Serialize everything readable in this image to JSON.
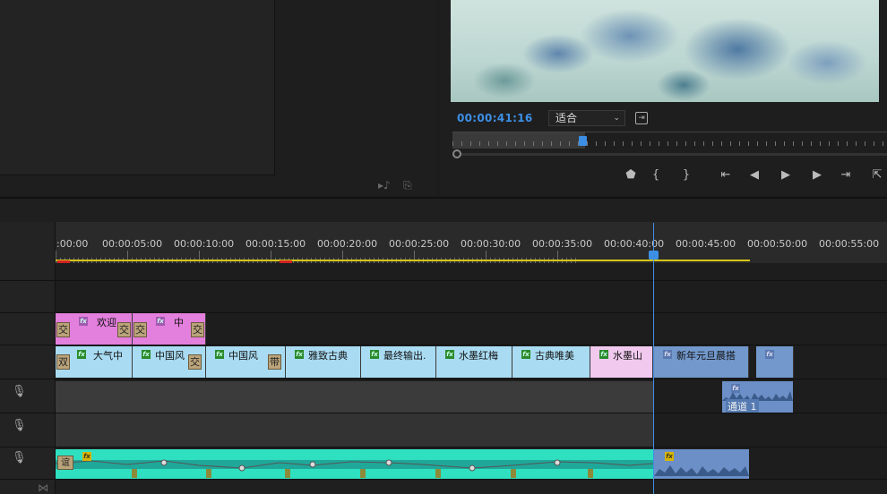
{
  "program": {
    "timecode": "00:00:41:16",
    "fit_value": "适合",
    "fit_arrow": "⌄",
    "res_icon": "⇥"
  },
  "transport": [
    {
      "name": "add-marker",
      "glyph": "⬟"
    },
    {
      "name": "mark-in",
      "glyph": "{"
    },
    {
      "name": "mark-out",
      "glyph": "}"
    },
    {
      "name": "go-to-in",
      "glyph": "⇤"
    },
    {
      "name": "step-back",
      "glyph": "◀"
    },
    {
      "name": "play",
      "glyph": "▶"
    },
    {
      "name": "step-forward",
      "glyph": "▶"
    },
    {
      "name": "go-to-out",
      "glyph": "⇥"
    },
    {
      "name": "lift",
      "glyph": "⇱"
    }
  ],
  "ruler": {
    "labels": [
      ":00:00",
      "00:00:05:00",
      "00:00:10:00",
      "00:00:15:00",
      "00:00:20:00",
      "00:00:25:00",
      "00:00:30:00",
      "00:00:35:00",
      "00:00:40:00",
      "00:00:45:00",
      "00:00:50:00",
      "00:00:55:00"
    ]
  },
  "tracks": {
    "v3": [
      {
        "label": "欢迎",
        "fx": "fx",
        "trans_left": "交",
        "trans_right": "交",
        "color": "#e37fdc"
      },
      {
        "label": "中",
        "fx": "fx",
        "trans_left": "交",
        "trans_right": "交",
        "color": "#e37fdc"
      }
    ],
    "v2": [
      {
        "label": "大气中",
        "fx": "fx",
        "trans": "双",
        "color": "#a9dcf3"
      },
      {
        "label": "中国风",
        "fx": "fx",
        "trans": "交",
        "color": "#a9dcf3"
      },
      {
        "label": "中国风",
        "fx": "fx",
        "trans": "带",
        "color": "#a9dcf3"
      },
      {
        "label": "雅致古典",
        "fx": "fx",
        "color": "#a9dcf3"
      },
      {
        "label": "最终输出.",
        "fx": "fx",
        "color": "#a9dcf3"
      },
      {
        "label": "水墨红梅",
        "fx": "fx",
        "color": "#a9dcf3"
      },
      {
        "label": "古典唯美",
        "fx": "fx",
        "color": "#a9dcf3"
      },
      {
        "label": "水墨山",
        "fx": "fx",
        "color": "#f1c9ef"
      },
      {
        "label": "新年元旦晨搭",
        "fx": "fx",
        "color": "#7298cc"
      },
      {
        "label": "",
        "fx": "fx",
        "color": "#7298cc"
      }
    ],
    "a1_clip": {
      "label": "通道 1",
      "fx": "fx"
    },
    "a3_clips": [
      {
        "label": "谊",
        "fx": "fx"
      },
      {
        "label": "",
        "fx": "fx"
      }
    ]
  },
  "colors": {
    "accent": "#3d8fe6",
    "work_area": "#d6c61a",
    "audio_green": "#2fe0c0",
    "audio_blue": "#6b8fc6"
  }
}
